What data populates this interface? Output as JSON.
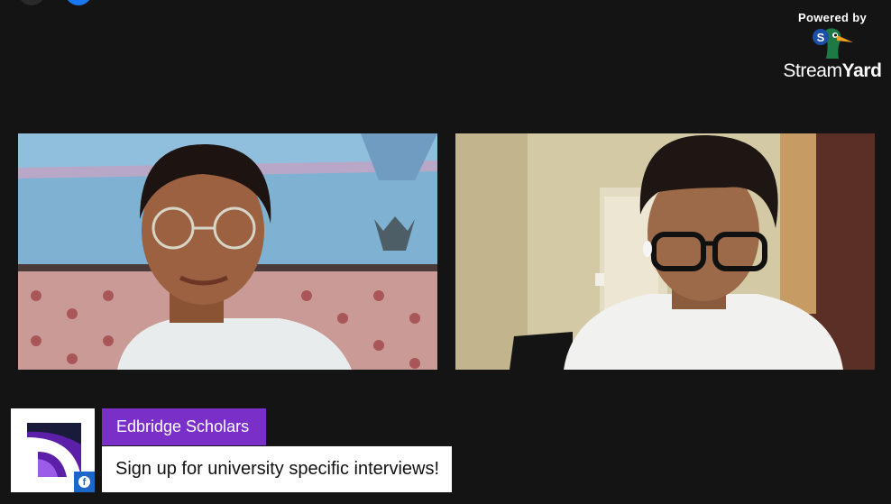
{
  "branding": {
    "powered_by": "Powered by",
    "brand_regular": "Stream",
    "brand_bold": "Yard",
    "logo_icon": "streamyard-duck-icon"
  },
  "participants": [
    {
      "camera_icon": "participant-left-camera"
    },
    {
      "camera_icon": "participant-right-camera"
    }
  ],
  "banner": {
    "name": "Edbridge Scholars",
    "message": "Sign up for university specific interviews!",
    "platform_icon": "facebook-icon",
    "platform_glyph": "f",
    "accent": "#7b2fc9"
  },
  "colors": {
    "background": "#141414",
    "facebook": "#1877f2"
  }
}
